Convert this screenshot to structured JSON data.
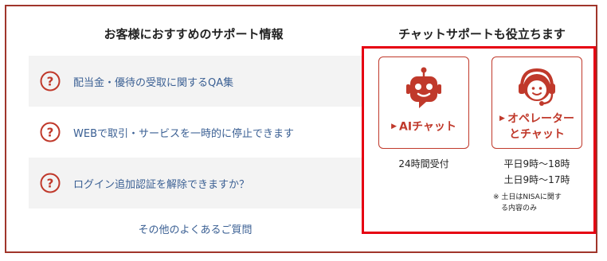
{
  "left": {
    "title": "お客様におすすめのサポート情報",
    "faqs": [
      {
        "text": "配当金・優待の受取に関するQA集"
      },
      {
        "text": "WEBで取引・サービスを一時的に停止できます"
      },
      {
        "text": "ログイン追加認証を解除できますか？"
      }
    ],
    "other_link": "その他のよくあるご質問"
  },
  "right": {
    "title": "チャットサポートも役立ちます",
    "ai_card": {
      "label": "AIチャット",
      "hours": "24時間受付"
    },
    "operator_card": {
      "label_line1": "オペレーター",
      "label_line2": "とチャット",
      "hours_weekday": "平日9時～18時",
      "hours_weekend": "土日9時～17時",
      "note_line1": "※ 土日はNISAに関す",
      "note_line2": "る内容のみ"
    }
  },
  "colors": {
    "accent": "#c0392b",
    "highlight_border": "#e60012",
    "link": "#3a5f93",
    "frame": "#a0352b"
  },
  "icons": {
    "faq": "question-circle-icon",
    "ai": "robot-icon",
    "operator": "headset-operator-icon",
    "triangle": "triangle-right-icon"
  }
}
